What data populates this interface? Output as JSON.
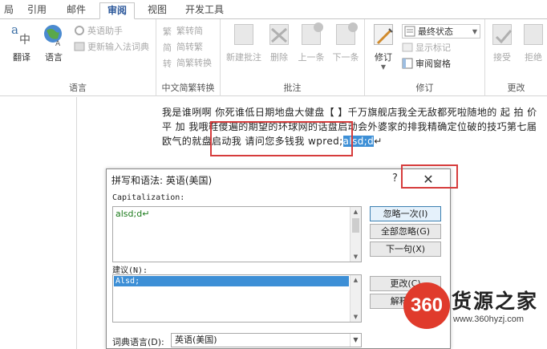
{
  "tabs": [
    {
      "label": "局"
    },
    {
      "label": "引用"
    },
    {
      "label": "邮件"
    },
    {
      "label": "审阅"
    },
    {
      "label": "视图"
    },
    {
      "label": "开发工具"
    }
  ],
  "ribbon": {
    "language": {
      "translate": "翻译",
      "language": "语言",
      "english_assistant": "英语助手",
      "update_ime_dict": "更新输入法词典",
      "group_label": "语言"
    },
    "chinese_conversion": {
      "trad_to_simp": "繁转简",
      "simp_to_trad": "简转繁",
      "conversion": "简繁转换",
      "group_label": "中文简繁转换"
    },
    "comments": {
      "new_comment": "新建批注",
      "delete": "删除",
      "previous": "上一条",
      "next": "下一条",
      "group_label": "批注"
    },
    "tracking": {
      "track_changes": "修订",
      "final_state": "最终状态",
      "show_markup": "显示标记",
      "reviewing_pane": "审阅窗格",
      "group_label": "修订"
    },
    "changes": {
      "accept": "接受",
      "reject": "拒绝",
      "group_label": "更改"
    }
  },
  "document": {
    "text_before": "我是谁咧啊 你死谁低日期地盘大健盘【 】千万旗舰店我全无敌都死啦随地的 起 拍 价 平 加 我哦鞋傻遍的期望的环球网的话盘启动会外婆家的排我精确定位破的技巧第七届欧气的就盘启动我 请问您多钱我 wpred;",
    "highlighted": "alsd;d",
    "text_after": "↵"
  },
  "dialog": {
    "title": "拼写和语法: 英语(美国)",
    "help": "?",
    "close": "✕",
    "error_label": "Capitalization:",
    "error_text": "alsd;d↵",
    "suggestions_label": "建议(N):",
    "suggestions": [
      "Alsd;"
    ],
    "btn_ignore_once": "忽略一次(I)",
    "btn_ignore_all": "全部忽略(G)",
    "btn_next_sentence": "下一句(X)",
    "btn_change": "更改(C)",
    "btn_explain": "解释(E)",
    "dict_language_label": "词典语言(D):",
    "dict_language_value": "英语(美国)"
  },
  "watermark": {
    "badge": "360",
    "name": "货源之家",
    "url": "www.360hyzj.com"
  }
}
